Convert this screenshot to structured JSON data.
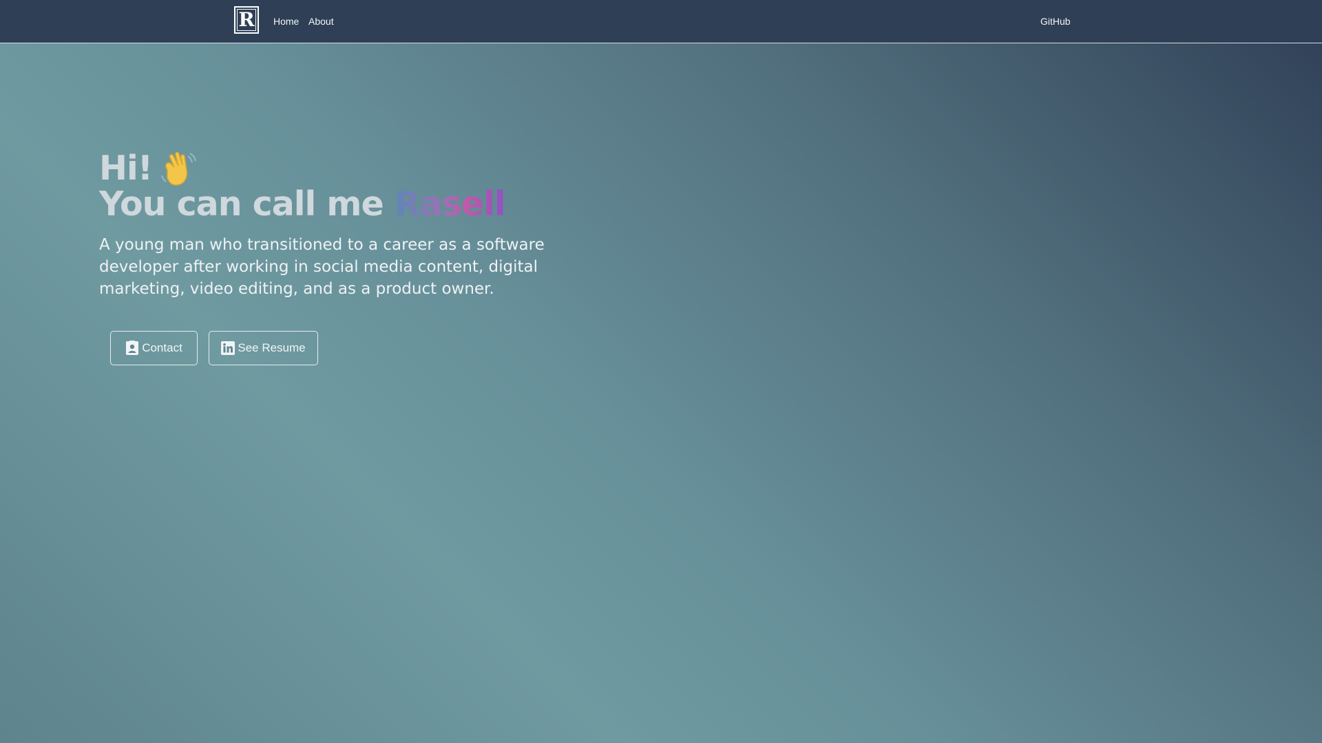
{
  "navbar": {
    "logo_letter": "R",
    "links": [
      {
        "label": "Home"
      },
      {
        "label": "About"
      }
    ],
    "github_label": "GitHub"
  },
  "hero": {
    "greeting": "Hi!",
    "title_prefix": "You can call me ",
    "name": "Rasell",
    "description": "A young man who transitioned to a career as a software developer after working in social media content, digital marketing, video editing, and as a product owner.",
    "buttons": {
      "contact_label": "Contact",
      "resume_label": "See Resume"
    }
  },
  "icons": {
    "greeting": "waving-hand-icon",
    "contact": "contact-card-icon",
    "resume": "linkedin-icon"
  },
  "colors": {
    "navbar_bg": "#2f3f56",
    "text_heading": "#cfd8dd",
    "name_gradient_start": "#5f86b7",
    "name_gradient_end": "#8f52c3"
  }
}
